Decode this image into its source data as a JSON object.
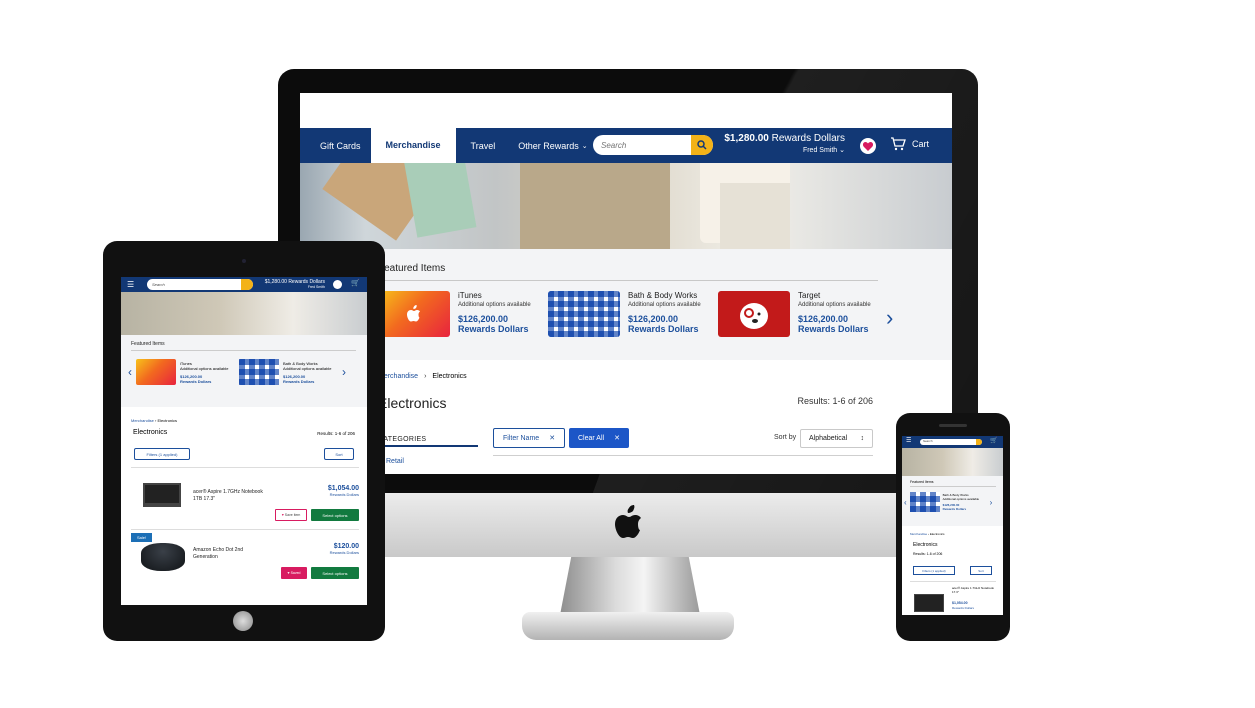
{
  "desktop": {
    "nav": {
      "tabs": [
        "Gift Cards",
        "Merchandise",
        "Travel",
        "Other Rewards"
      ],
      "active_tab": "Merchandise",
      "search_placeholder": "Search",
      "balance_amount": "$1,280.00",
      "balance_unit": "Rewards Dollars",
      "user": "Fred Smith",
      "cart_label": "Cart"
    },
    "featured": {
      "title": "Featured Items",
      "items": [
        {
          "name": "iTunes",
          "options": "Additional options available",
          "price": "$126,200.00",
          "unit": "Rewards Dollars"
        },
        {
          "name": "Bath & Body Works",
          "options": "Additional options available",
          "price": "$126,200.00",
          "unit": "Rewards Dollars"
        },
        {
          "name": "Target",
          "options": "Additional options available",
          "price": "$126,200.00",
          "unit": "Rewards Dollars"
        }
      ]
    },
    "breadcrumb": {
      "parent": "Merchandise",
      "current": "Electronics"
    },
    "page_title": "Electronics",
    "results": "Results: 1-6 of 206",
    "categories_label": "CATEGORIES",
    "category_retail": "Retail",
    "filter_chip": "Filter Name",
    "clear_chip": "Clear All",
    "sort_label": "Sort by",
    "sort_value": "Alphabetical"
  },
  "tablet": {
    "search_placeholder": "Search",
    "balance": "$1,280.00 Rewards Dollars",
    "user": "Fred Smith",
    "featured_title": "Featured Items",
    "items": [
      {
        "name": "iTunes",
        "options": "Additional options available",
        "price": "$126,200.00",
        "unit": "Rewards Dollars"
      },
      {
        "name": "Bath & Body Works",
        "options": "Additional options available",
        "price": "$126,200.00",
        "unit": "Rewards Dollars"
      }
    ],
    "breadcrumb_parent": "Merchandise",
    "breadcrumb_current": "Electronics",
    "page_title": "Electronics",
    "results": "Results: 1-6 of 206",
    "filters_button": "Filters (1 applied)",
    "sort_button": "Sort",
    "products": [
      {
        "name": "acer® Aspire 1.7GHz Notebook 1TB 17.3\"",
        "price": "$1,054.00",
        "unit": "Rewards Dollars",
        "save": "Save item",
        "select": "Select options",
        "badge": ""
      },
      {
        "name": "Amazon Echo Dot 2nd Generation",
        "price": "$120.00",
        "unit": "Rewards Dollars",
        "save": "Saved",
        "select": "Select options",
        "badge": "Sale!"
      }
    ]
  },
  "phone": {
    "search_placeholder": "Search",
    "featured_title": "Featured Items",
    "item_name": "Bath & Body Works",
    "item_options": "Additional options available",
    "item_price": "$126,200.00",
    "item_unit": "Rewards Dollars",
    "breadcrumb_parent": "Merchandise",
    "breadcrumb_current": "Electronics",
    "page_title": "Electronics",
    "results": "Results: 1-6 of 206",
    "filters_button": "Filters (1 applied)",
    "sort_button": "Sort",
    "product_name": "acer® Aspire 1.7GHz Notebook 17.3\"",
    "product_price": "$1,054.00",
    "product_unit": "Rewards Dollars"
  },
  "colors": {
    "nav": "#123875",
    "accent": "#f3b218",
    "link": "#1c4f9c",
    "select": "#127a3f",
    "heart": "#d81b60"
  }
}
